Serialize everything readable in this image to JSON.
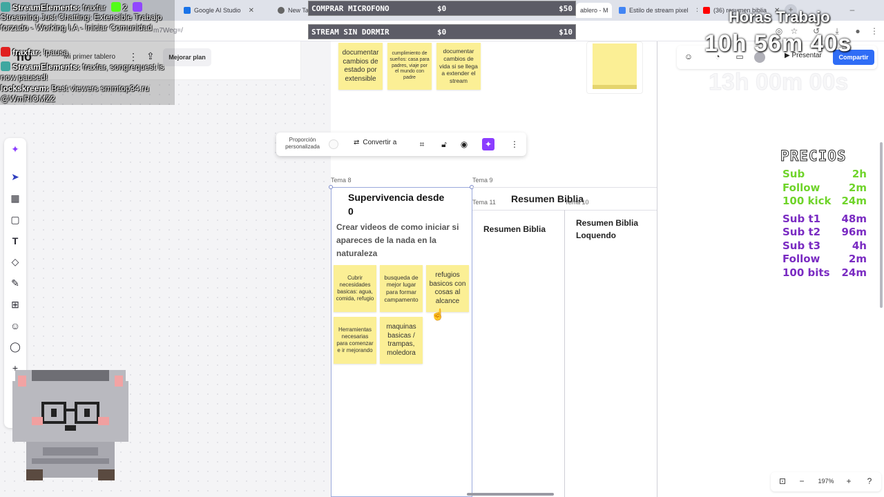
{
  "browser": {
    "tabs": [
      {
        "label": "",
        "active": false
      },
      {
        "label": "Google AI Studio",
        "active": false
      },
      {
        "label": "New Tab",
        "active": false
      },
      {
        "label": "ablero - M",
        "active": true
      },
      {
        "label": "Estilo de stream pixel",
        "active": false
      },
      {
        "label": "(36) resumen biblia",
        "active": false
      }
    ],
    "url_fragment": "m7Weg=/"
  },
  "app": {
    "logo_text": "ho",
    "board_title": "Mi primer tablero",
    "upgrade_label": "Mejorar plan",
    "present_label": "Presentar",
    "share_label": "Compartir",
    "zoom_level": "197%",
    "right_icons": [
      "icon-a",
      "icon-b",
      "icon-c",
      "icon-d"
    ]
  },
  "left_toolbar": {
    "tools": [
      "sparkle-icon",
      "cursor-icon",
      "layout-icon",
      "sticky-note-icon",
      "text-icon",
      "shapes-icon",
      "pen-icon",
      "frame-icon",
      "sticker-icon",
      "comment-icon",
      "plus-icon"
    ]
  },
  "floating_toolbar": {
    "proportion_label": "Proporción personalizada",
    "convert_label": "Convertir a"
  },
  "top_stickies": [
    "documentar cambios de estado por extensible",
    "cumplimiento de sueños: casa para padres, viaje por el mundo con padre",
    "documentar cambios de vida si se llega a extender el stream"
  ],
  "topics": {
    "t8": {
      "label": "Tema 8",
      "title": "Supervivencia desde 0",
      "subtitle": "Crear videos de como iniciar si apareces de la nada en la naturaleza"
    },
    "t9": {
      "label": "Tema 9",
      "title": "Resumen Biblia"
    },
    "t10": {
      "label": "Tema 10",
      "title": "Resumen Biblia Loquendo"
    },
    "t11": {
      "label": "Tema 11",
      "title": "Resumen Biblia"
    }
  },
  "t8_stickies": [
    "Cubrir necesidades basicas: agua, comida, refugio",
    "busqueda de mejor lugar para formar campamento",
    "refugios basicos con cosas al alcance",
    "Herramientas necesarias para comenzar e ir mejorando",
    "maquinas basicas / trampas, moledora"
  ],
  "chat": {
    "line1_user": "StreamElements:",
    "line1_msg": "fraxfar",
    "line1_count": "2",
    "line2": "Streaming Just Chatting: Extensible Trabajo forzado - Working I.A - Iniciar Comunidad",
    "line3_user": "fraxfar:",
    "line3_msg": "!pausa",
    "line4_user": "StreamElements:",
    "line4_msg": "fraxfar, songrequest is now paused!",
    "line5_user": "lockskreem:",
    "line5_msg": "Best viewers smmtop34.ru @WmRIOMZ2"
  },
  "goals": [
    {
      "name": "COMPRAR MICROFONO",
      "current": "$0",
      "target": "$50"
    },
    {
      "name": "STREAM SIN DORMIR",
      "current": "$0",
      "target": "$10"
    }
  ],
  "hours": {
    "title": "Horas Trabajo",
    "time": "10h 56m 40s",
    "time2": "13h 00m 00s"
  },
  "prices": {
    "title": "PRECIOS",
    "rows": [
      {
        "label": "Sub",
        "value": "2h",
        "color": "#6fd42a"
      },
      {
        "label": "Follow",
        "value": "2m",
        "color": "#6fd42a"
      },
      {
        "label": "100 kick",
        "value": "24m",
        "color": "#6fd42a"
      },
      {
        "label": "Sub t1",
        "value": "48m",
        "color": "#7a2bc2"
      },
      {
        "label": "Sub t2",
        "value": "96m",
        "color": "#7a2bc2"
      },
      {
        "label": "Sub t3",
        "value": "4h",
        "color": "#7a2bc2"
      },
      {
        "label": "Follow",
        "value": "2m",
        "color": "#7a2bc2"
      },
      {
        "label": "100 bits",
        "value": "24m",
        "color": "#7a2bc2"
      }
    ]
  }
}
